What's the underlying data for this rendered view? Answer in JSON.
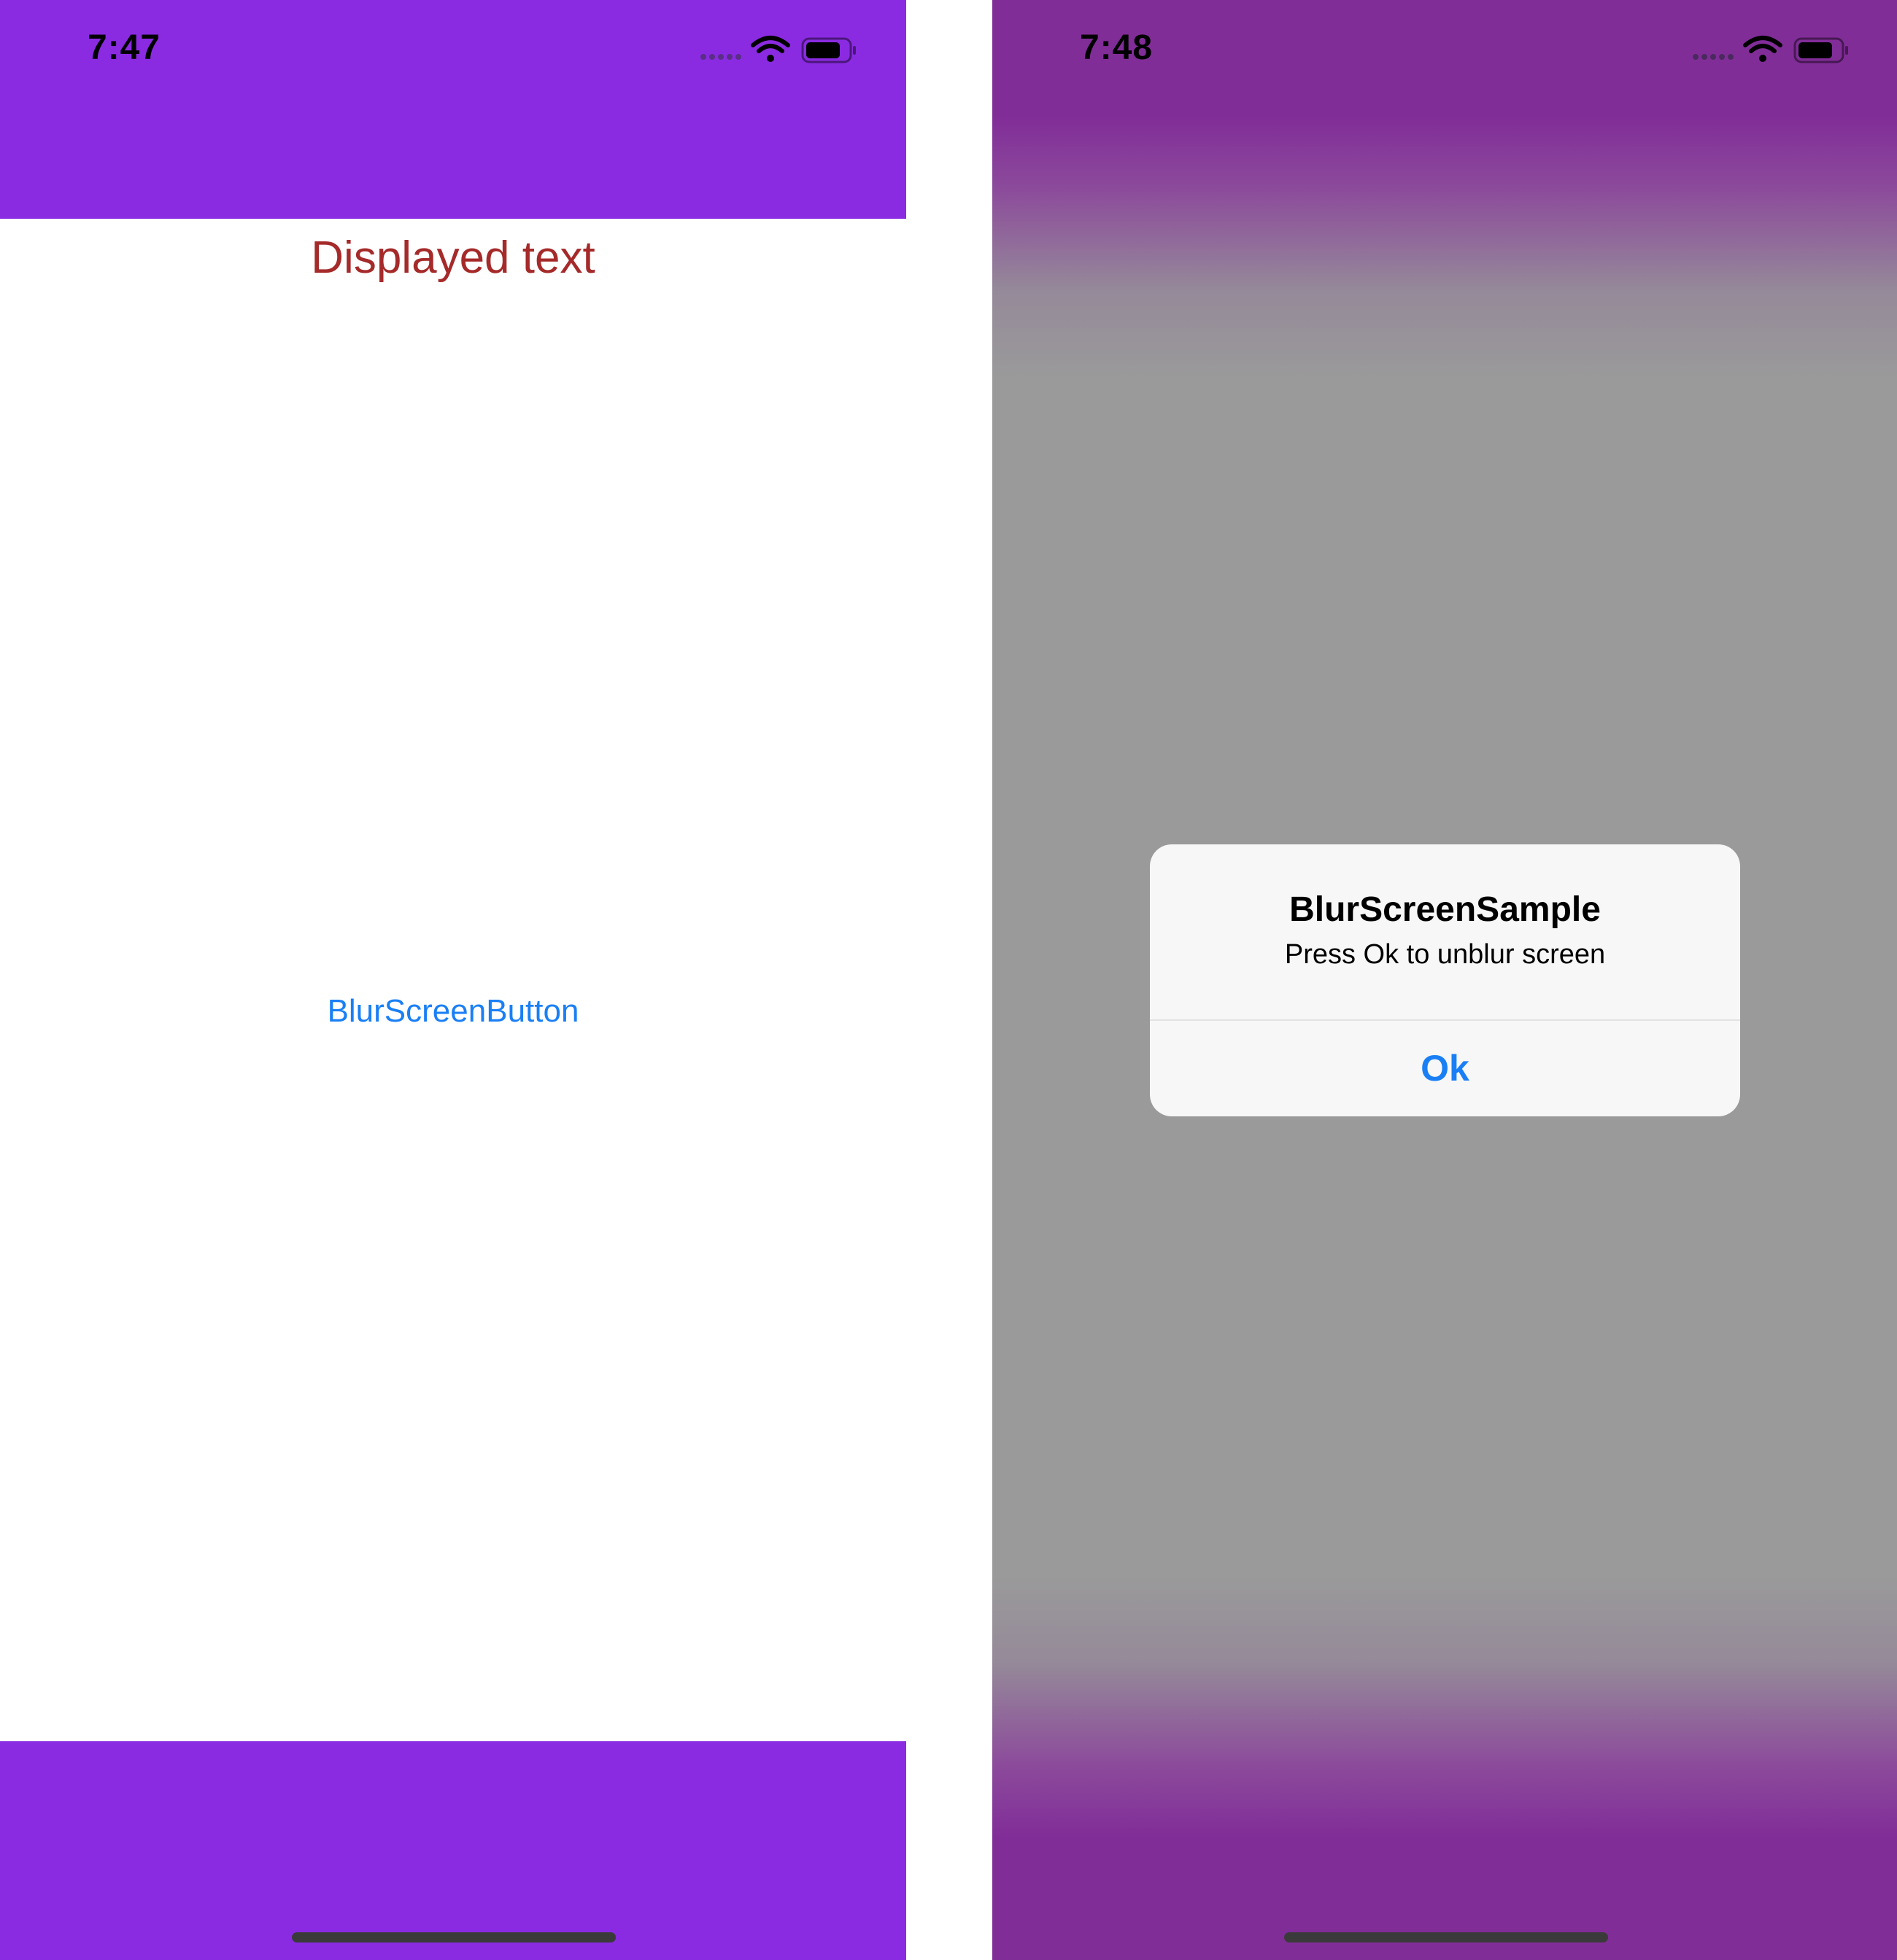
{
  "left_screen": {
    "status_time": "7:47",
    "displayed_text": "Displayed text",
    "blur_button_label": "BlurScreenButton"
  },
  "right_screen": {
    "status_time": "7:48",
    "alert": {
      "title": "BlurScreenSample",
      "message": "Press Ok to unblur screen",
      "ok_label": "Ok"
    }
  },
  "colors": {
    "nav_bar": "#8a2be2",
    "displayed_text": "#a52a2a",
    "button_text": "#1a7ff5",
    "blur_overlay": "#9a9a9a",
    "blurred_bar": "#812d98",
    "alert_background": "#f7f7f7"
  },
  "icons": [
    "signal-dots-icon",
    "wifi-icon",
    "battery-icon"
  ]
}
